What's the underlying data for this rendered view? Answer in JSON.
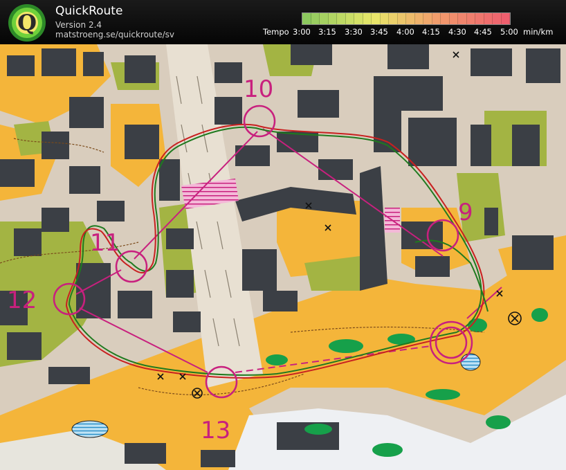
{
  "app": {
    "title": "QuickRoute",
    "version": "Version 2.4",
    "url": "matstroeng.se/quickroute/sv",
    "logo_letter": "Q"
  },
  "legend": {
    "label": "Tempo",
    "ticks": [
      "3:00",
      "3:15",
      "3:30",
      "3:45",
      "4:00",
      "4:15",
      "4:30",
      "4:45",
      "5:00"
    ],
    "unit": "min/km",
    "gradient_colors": [
      "#8dc95e",
      "#e9e86a",
      "#f19a6c",
      "#ef5f6e"
    ]
  },
  "map": {
    "controls": [
      {
        "label": "9"
      },
      {
        "label": "10"
      },
      {
        "label": "11"
      },
      {
        "label": "12"
      },
      {
        "label": "13"
      }
    ],
    "colors": {
      "course": "#c8207e",
      "open_land": "#f6b93c",
      "forest": "#9cb03f",
      "building": "#3b3f45",
      "paved": "#d8cdbd",
      "water": "#e9ecf0",
      "route_green": "#1f7a1f",
      "route_red": "#c82020"
    }
  }
}
